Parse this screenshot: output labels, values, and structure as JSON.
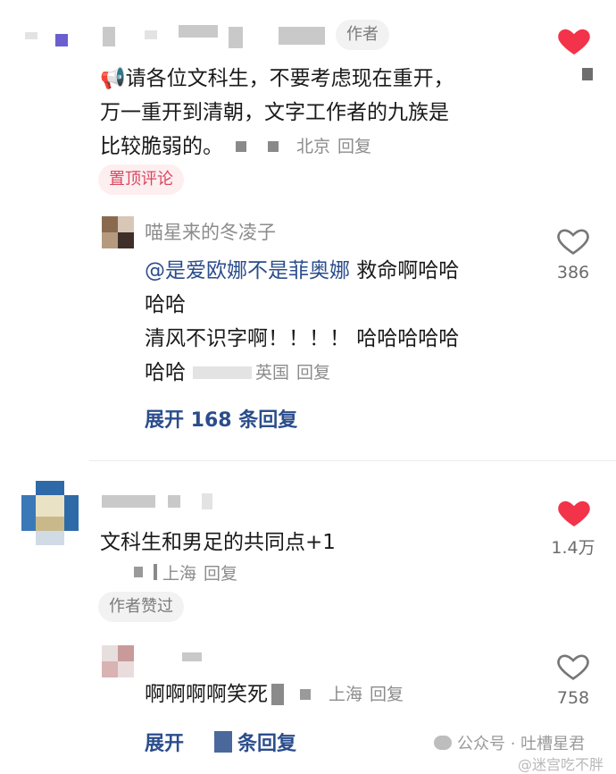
{
  "comments": [
    {
      "author_tag": "作者",
      "text_lines": [
        "📢请各位文科生，不要考虑现在重开，",
        "万一重开到清朝，文字工作者的九族是",
        "比较脆弱的。"
      ],
      "location": "北京",
      "reply": "回复",
      "pinned": "置顶评论",
      "liked": true,
      "replies": [
        {
          "author": "喵星来的冬凌子",
          "mention": "@是爱欧娜不是菲奥娜",
          "line1_rest": " 救命啊哈哈",
          "line2": "哈哈",
          "line3": "清风不识字啊！！！！ 哈哈哈哈哈",
          "line4": "哈哈",
          "location": "英国",
          "reply": "回复",
          "likes": "386"
        }
      ],
      "expand": "展开 168 条回复"
    },
    {
      "text": "文科生和男足的共同点+1",
      "location": "上海",
      "reply": "回复",
      "author_liked": "作者赞过",
      "likes": "1.4万",
      "liked": true,
      "replies": [
        {
          "text": "啊啊啊啊笑死",
          "location": "上海",
          "reply": "回复",
          "likes": "758"
        }
      ],
      "expand_prefix": "展开",
      "expand_suffix": "条回复"
    }
  ],
  "watermark": {
    "account": "公众号 · 吐槽星君",
    "site": "@迷宫吃不胖"
  },
  "colors": {
    "heart_red": "#f2334a",
    "link_blue": "#2b4d8c",
    "pinned_bg": "#fdeef0",
    "pinned_text": "#d9485f"
  }
}
